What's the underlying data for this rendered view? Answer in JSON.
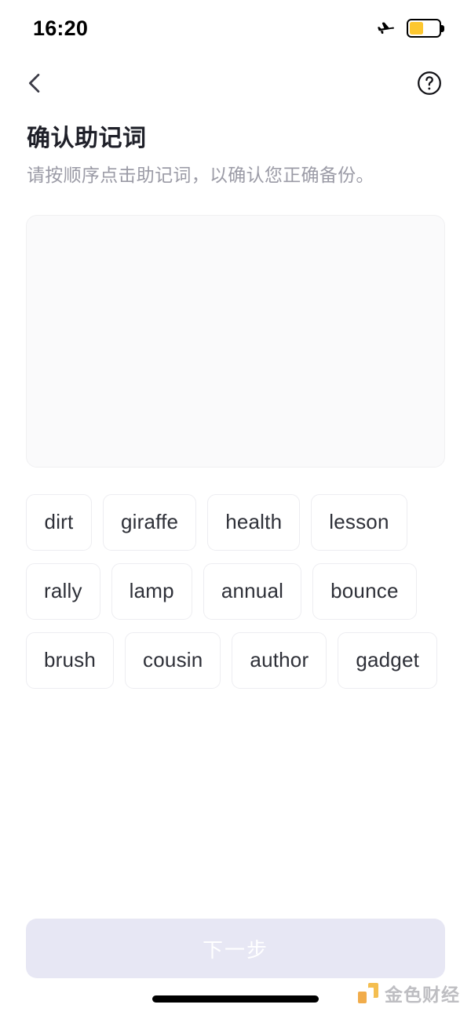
{
  "status_bar": {
    "time": "16:20",
    "airplane_icon": "airplane-icon",
    "battery_icon": "battery-icon",
    "battery_level_percent": 40,
    "battery_fill_color": "#fdc72f"
  },
  "nav": {
    "back_icon": "chevron-left-icon",
    "help_icon": "question-mark-circle-icon"
  },
  "header": {
    "title": "确认助记词",
    "subtitle": "请按顺序点击助记词，以确认您正确备份。"
  },
  "answer_area": {
    "selected_words": [],
    "background_color": "#fafafb",
    "border_color": "#f0f0f2"
  },
  "word_bank": {
    "words": [
      "dirt",
      "giraffe",
      "health",
      "lesson",
      "rally",
      "lamp",
      "annual",
      "bounce",
      "brush",
      "cousin",
      "author",
      "gadget"
    ]
  },
  "footer": {
    "next_label": "下一步",
    "next_enabled": false,
    "next_background_color": "#e7e7f4",
    "next_text_color": "#ffffff"
  },
  "watermark": {
    "text": "金色财经",
    "logo_color": "#f4b942"
  }
}
